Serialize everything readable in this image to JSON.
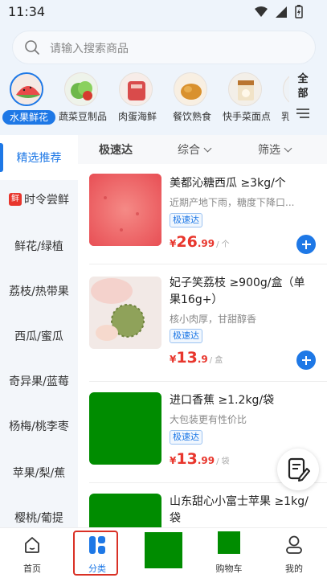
{
  "status_bar": {
    "time": "11:34"
  },
  "search": {
    "placeholder": "请输入搜索商品"
  },
  "categories": [
    {
      "label": "水果鲜花",
      "icon": "watermelon-icon",
      "active": true
    },
    {
      "label": "蔬菜豆制品",
      "icon": "lettuce-icon"
    },
    {
      "label": "肉蛋海鲜",
      "icon": "meat-icon"
    },
    {
      "label": "餐饮熟食",
      "icon": "fried-chicken-icon"
    },
    {
      "label": "快手菜面点",
      "icon": "dumpling-pack-icon"
    },
    {
      "label": "乳",
      "icon": "dairy-icon"
    }
  ],
  "all_button": {
    "line1": "全",
    "line2": "部"
  },
  "sidebar": {
    "items": [
      {
        "label": "精选推荐",
        "active": true
      },
      {
        "label": "时令尝鲜",
        "badge": "鲜"
      },
      {
        "label": "鲜花/绿植"
      },
      {
        "label": "荔枝/热带果"
      },
      {
        "label": "西瓜/蜜瓜"
      },
      {
        "label": "奇异果/蓝莓"
      },
      {
        "label": "杨梅/桃李枣"
      },
      {
        "label": "苹果/梨/蕉"
      },
      {
        "label": "樱桃/葡提"
      }
    ]
  },
  "filters": {
    "speed": "极速达",
    "sort": "综合",
    "screen": "筛选"
  },
  "products": [
    {
      "title": "美都沁糖西瓜 ≥3kg/个",
      "subtitle": "近期产地下雨，糖度下降口...",
      "tag": "极速达",
      "currency": "¥",
      "price_int": "26",
      "price_dec": ".99",
      "unit": "/ 个"
    },
    {
      "title": "妃子笑荔枝 ≥900g/盒（单果16g+）",
      "subtitle": "核小肉厚，甘甜醇香",
      "tag": "极速达",
      "currency": "¥",
      "price_int": "13",
      "price_dec": ".9",
      "unit": "/ 盒"
    },
    {
      "title": "进口香蕉 ≥1.2kg/袋",
      "subtitle": "大包装更有性价比",
      "tag": "极速达",
      "currency": "¥",
      "price_int": "13",
      "price_dec": ".99",
      "unit": "/ 袋"
    },
    {
      "title": "山东甜心小富士苹果 ≥1kg/袋"
    }
  ],
  "bottom_nav": [
    {
      "label": "首页",
      "icon": "home-icon"
    },
    {
      "label": "分类",
      "icon": "category-icon",
      "active": true
    },
    {
      "label": "",
      "icon": "placeholder-block"
    },
    {
      "label": "购物车",
      "icon": "cart-icon"
    },
    {
      "label": "我的",
      "icon": "profile-icon"
    }
  ],
  "colors": {
    "accent": "#1e78e6",
    "price": "#e8362d",
    "highlight": "#d93025",
    "placeholder_green": "#008c00"
  }
}
